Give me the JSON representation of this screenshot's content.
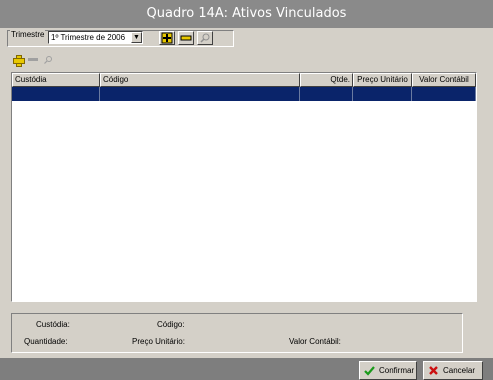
{
  "window": {
    "title": "Quadro 14A: Ativos Vinculados"
  },
  "filter": {
    "label": "Trimestre",
    "selected": "1º Trimestre de 2006"
  },
  "toolbar": {
    "icons": [
      "add-icon",
      "remove-icon",
      "search-icon"
    ]
  },
  "grid": {
    "columns": [
      "Custódia",
      "Código",
      "Qtde.",
      "Preço Unitário",
      "Valor Contábil"
    ],
    "rows": [
      [
        "",
        "",
        "",
        "",
        ""
      ]
    ]
  },
  "details": {
    "custodia_label": "Custódia:",
    "codigo_label": "Código:",
    "quantidade_label": "Quantidade:",
    "preco_label": "Preço Unitário:",
    "valor_label": "Valor Contábil:"
  },
  "buttons": {
    "confirm": "Confirmar",
    "cancel": "Cancelar"
  },
  "colors": {
    "title_bar": "#8a8a8a",
    "selection": "#0a246a",
    "face": "#d4d0c8"
  }
}
